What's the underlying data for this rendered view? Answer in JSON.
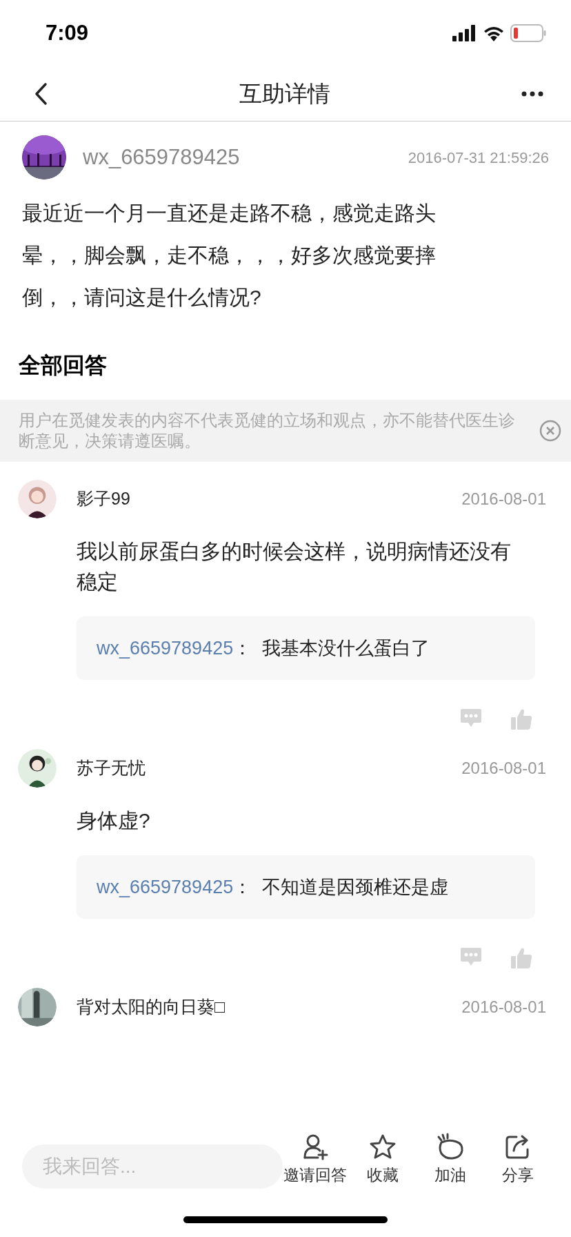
{
  "status_bar": {
    "time": "7:09"
  },
  "nav": {
    "title": "互助详情"
  },
  "post": {
    "author": "wx_6659789425",
    "time": "2016-07-31 21:59:26",
    "text": "最近近一个月一直还是走路不稳，感觉走路头晕，，脚会飘，走不稳，，，好多次感觉要摔倒，，请问这是什么情况?"
  },
  "answers_header": "全部回答",
  "notice": {
    "text": "用户在觅健发表的内容不代表觅健的立场和观点，亦不能替代医生诊断意见，决策请遵医嘱。"
  },
  "answers": [
    {
      "author": "影子99",
      "date": "2016-08-01",
      "text": "我以前尿蛋白多的时候会这样，说明病情还没有稳定",
      "reply": {
        "author": "wx_6659789425",
        "text": "：  我基本没什么蛋白了"
      }
    },
    {
      "author": "苏子无忧",
      "date": "2016-08-01",
      "text": "身体虚?",
      "reply": {
        "author": "wx_6659789425",
        "text": "：  不知道是因颈椎还是虚"
      }
    },
    {
      "author": "背对太阳的向日葵□",
      "date": "2016-08-01"
    }
  ],
  "bottom_bar": {
    "placeholder": "我来回答...",
    "actions": [
      {
        "kind": "invite",
        "label": "邀请回答"
      },
      {
        "kind": "favorite",
        "label": "收藏"
      },
      {
        "kind": "cheer",
        "label": "加油"
      },
      {
        "kind": "share",
        "label": "分享"
      }
    ]
  }
}
